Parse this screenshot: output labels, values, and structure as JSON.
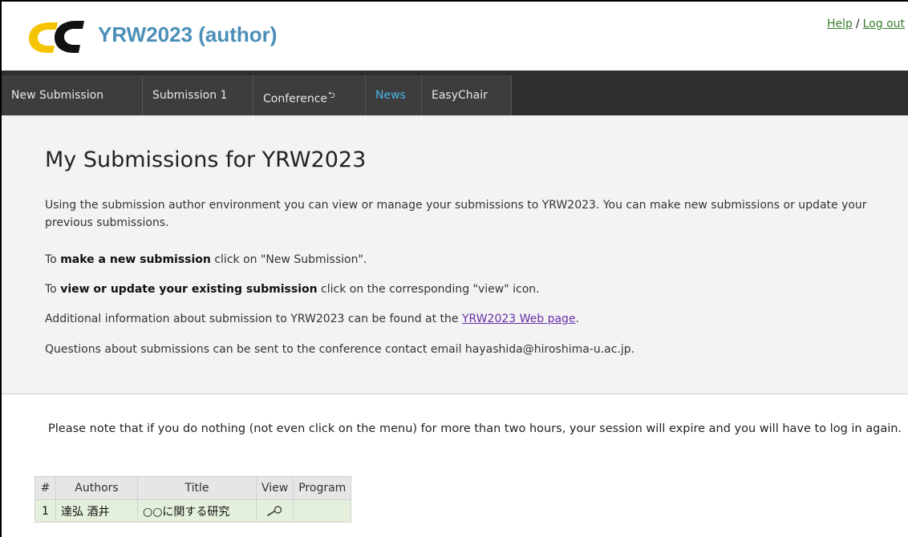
{
  "header": {
    "app_title": "YRW2023 (author)",
    "logo_text": "EC",
    "help_label": "Help",
    "separator": "/",
    "logout_label": "Log out"
  },
  "nav": {
    "items": [
      {
        "label": "New Submission"
      },
      {
        "label": "Submission 1"
      },
      {
        "label": "Conference",
        "mark": "⮌"
      },
      {
        "label": "News"
      },
      {
        "label": "EasyChair"
      }
    ]
  },
  "intro": {
    "title": "My Submissions for YRW2023",
    "p1": "Using the submission author environment you can view or manage your submissions to YRW2023. You can make new submissions or update your previous submissions.",
    "p2_pre": "To ",
    "p2_bold": "make a new submission",
    "p2_post": " click on \"New Submission\".",
    "p3_pre": "To ",
    "p3_bold": "view or update your existing submission",
    "p3_post": " click on the corresponding \"view\" icon.",
    "p4_pre": "Additional information about submission to YRW2023 can be found at the ",
    "p4_link": "YRW2023 Web page",
    "p4_post": ".",
    "p5": "Questions about submissions can be sent to the conference contact email hayashida@hiroshima-u.ac.jp."
  },
  "note": "Please note that if you do nothing (not even click on the menu) for more than two hours, your session will expire and you will have to log in again.",
  "table": {
    "headers": [
      "#",
      "Authors",
      "Title",
      "View",
      "Program"
    ],
    "rows": [
      {
        "num": "1",
        "authors": "達弘 酒井",
        "title": "○○に関する研究",
        "program": ""
      }
    ]
  },
  "colors": {
    "title_blue": "#4b8fb8",
    "nav_active": "#49b5e8",
    "logo_yellow": "#f5c400",
    "row_green": "#e4f0dc"
  }
}
